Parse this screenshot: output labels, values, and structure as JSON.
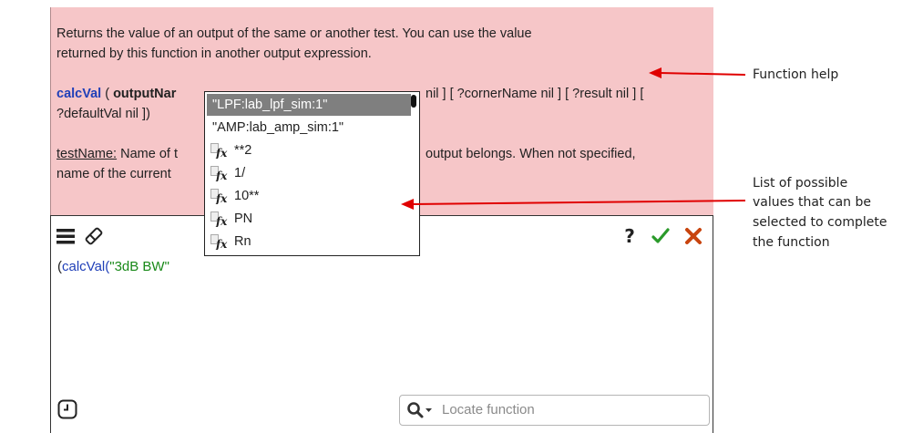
{
  "help": {
    "line1": "Returns the value of an output of the same or another test. You can use the value",
    "line2": "returned by this function in another output expression.",
    "sig_fn": "calcVal",
    "sig_open": " ( ",
    "sig_arg": "outputNar",
    "sig_rest": "nil ] [ ?cornerName nil ] [ ?result nil ] [",
    "sig_line2": "?defaultVal nil ])",
    "param_name": "testName:",
    "param_text": " Name of t",
    "param_rest": "output belongs. When not specified,",
    "param_line2": "name of the current"
  },
  "editor": {
    "code_open": "(",
    "code_fn": "calcVal",
    "code_paren": "(",
    "code_str": "\"3dB BW\"",
    "help_label": "?",
    "search_placeholder": "Locate function"
  },
  "popup": {
    "items": [
      {
        "label": "\"LPF:lab_lpf_sim:1\"",
        "selected": true,
        "fx": false
      },
      {
        "label": "\"AMP:lab_amp_sim:1\"",
        "selected": false,
        "fx": false
      },
      {
        "label": "**2",
        "selected": false,
        "fx": true
      },
      {
        "label": "1/",
        "selected": false,
        "fx": true
      },
      {
        "label": "10**",
        "selected": false,
        "fx": true
      },
      {
        "label": "PN",
        "selected": false,
        "fx": true
      },
      {
        "label": "Rn",
        "selected": false,
        "fx": true
      }
    ]
  },
  "annotations": {
    "function_help": "Function help",
    "list_line1": "List of possible",
    "list_line2": "values that can be",
    "list_line3": "selected to complete",
    "list_line4": "the function"
  },
  "colors": {
    "help_bg": "#f6c6c8",
    "arrow": "#e00000",
    "function_blue": "#1f3fb8",
    "string_green": "#1a8a1a",
    "check_green": "#2a9a2a",
    "cancel_orange": "#c8440e"
  },
  "icons": {
    "menu": "hamburger-menu-icon",
    "eraser": "eraser-icon",
    "help": "question-mark-icon",
    "ok": "checkmark-icon",
    "cancel": "close-icon",
    "clock": "clock-icon",
    "search": "magnifier-icon",
    "fx": "function-fx-icon"
  }
}
